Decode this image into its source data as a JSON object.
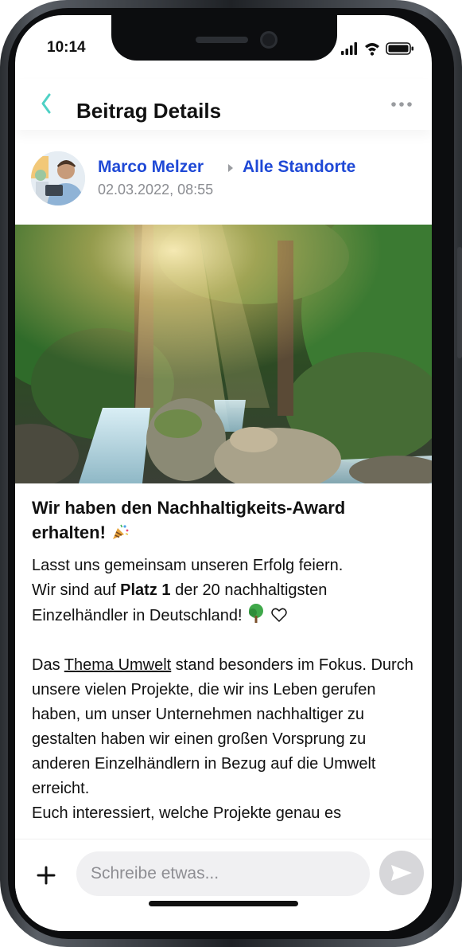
{
  "status_bar": {
    "time": "10:14"
  },
  "header": {
    "title": "Beitrag Details",
    "back_icon": "chevron-left-icon",
    "more_icon": "more-horizontal-icon",
    "accent_color": "#4fd1c5"
  },
  "post": {
    "author": "Marco Melzer",
    "audience": "Alle Standorte",
    "timestamp": "02.03.2022, 08:55",
    "link_color": "#1f49d6",
    "title": "Wir haben den Nachhaltigkeits-Award erhalten!",
    "title_emoji": "party-popper-icon",
    "paragraph1": {
      "line1": "Lasst uns gemeinsam unseren Erfolg feiern.",
      "line2_before": "Wir sind auf ",
      "line2_bold": "Platz 1",
      "line2_after": " der 20 nachhaltigsten",
      "line3": "Einzelhändler in Deutschland!",
      "emojis": [
        "tree-icon",
        "heart-outline-icon"
      ]
    },
    "paragraph2": {
      "before": "Das ",
      "underlined": "Thema Umwelt",
      "after": " stand besonders im Fokus. Durch unsere vielen Projekte, die wir ins Leben gerufen haben, um unser Unternehmen nachhaltiger zu gestalten haben wir einen großen Vorsprung zu anderen Einzelhändlern in Bezug auf die Umwelt erreicht.",
      "cut_line": "Euch interessiert, welche Projekte genau es"
    }
  },
  "composer": {
    "placeholder": "Schreibe etwas...",
    "add_icon": "plus-icon",
    "send_icon": "send-icon"
  }
}
